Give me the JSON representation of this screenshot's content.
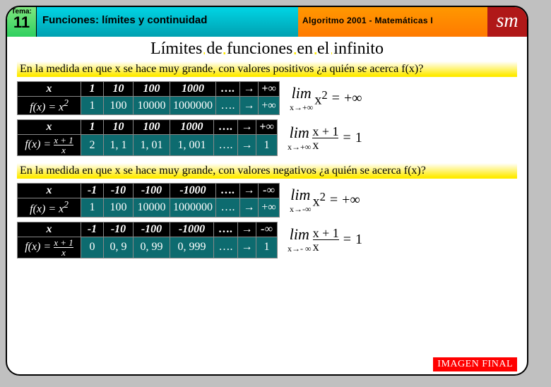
{
  "header": {
    "tema_label": "Tema:",
    "tema_num": "11",
    "topic": "Funciones: límites y continuidad",
    "source": "Algoritmo 2001 - Matemáticas I",
    "logo": "sm"
  },
  "main_title": "Límites de funciones en el infinito",
  "question_pos": "En la medida en que x se hace muy grande, con valores positivos ¿a quién se acerca f(x)?",
  "question_neg": "En la medida en que x se hace muy grande, con valores negativos ¿a quién se acerca f(x)?",
  "table1": {
    "x_label": "x",
    "fx_label_a": "f(x) =",
    "fx_label_b": "x",
    "fx_sup": "2",
    "header": [
      "1",
      "10",
      "100",
      "1000",
      "….",
      "→",
      "+∞"
    ],
    "values": [
      "1",
      "100",
      "10000",
      "1000000",
      "….",
      "→",
      "+∞"
    ]
  },
  "lim1": {
    "approach": "x→+∞",
    "expr_a": "x",
    "expr_sup": "2",
    "result": "+∞"
  },
  "table2": {
    "x_label": "x",
    "fx_label": "f(x) =",
    "frac_top": "x + 1",
    "frac_bot": "x",
    "header": [
      "1",
      "10",
      "100",
      "1000",
      "….",
      "→",
      "+∞"
    ],
    "values": [
      "2",
      "1, 1",
      "1, 01",
      "1, 001",
      "….",
      "→",
      "1"
    ]
  },
  "lim2": {
    "approach": "x→+∞",
    "frac_top": "x + 1",
    "frac_bot": "x",
    "result": "1"
  },
  "table3": {
    "x_label": "x",
    "fx_label_a": "f(x) =",
    "fx_label_b": "x",
    "fx_sup": "2",
    "header": [
      "-1",
      "-10",
      "-100",
      "-1000",
      "….",
      "→",
      "-∞"
    ],
    "values": [
      "1",
      "100",
      "10000",
      "1000000",
      "….",
      "→",
      "+∞"
    ]
  },
  "lim3": {
    "approach": "x→-∞",
    "expr_a": "x",
    "expr_sup": "2",
    "result": "+∞"
  },
  "table4": {
    "x_label": "x",
    "fx_label": "f(x) =",
    "frac_top": "x + 1",
    "frac_bot": "x",
    "header": [
      "-1",
      "-10",
      "-100",
      "-1000",
      "….",
      "→",
      "-∞"
    ],
    "values": [
      "0",
      "0, 9",
      "0, 99",
      "0, 999",
      "….",
      "→",
      "1"
    ]
  },
  "lim4": {
    "approach": "x→- ∞",
    "frac_top": "x + 1",
    "frac_bot": "x",
    "result": "1"
  },
  "final_btn": "IMAGEN FINAL",
  "chart_data": [
    {
      "type": "table",
      "title": "f(x)=x^2, x→+∞",
      "x": [
        1,
        10,
        100,
        1000
      ],
      "fx": [
        1,
        100,
        10000,
        1000000
      ],
      "limit": "+∞"
    },
    {
      "type": "table",
      "title": "f(x)=(x+1)/x, x→+∞",
      "x": [
        1,
        10,
        100,
        1000
      ],
      "fx": [
        2,
        1.1,
        1.01,
        1.001
      ],
      "limit": 1
    },
    {
      "type": "table",
      "title": "f(x)=x^2, x→-∞",
      "x": [
        -1,
        -10,
        -100,
        -1000
      ],
      "fx": [
        1,
        100,
        10000,
        1000000
      ],
      "limit": "+∞"
    },
    {
      "type": "table",
      "title": "f(x)=(x+1)/x, x→-∞",
      "x": [
        -1,
        -10,
        -100,
        -1000
      ],
      "fx": [
        0,
        0.9,
        0.99,
        0.999
      ],
      "limit": 1
    }
  ]
}
